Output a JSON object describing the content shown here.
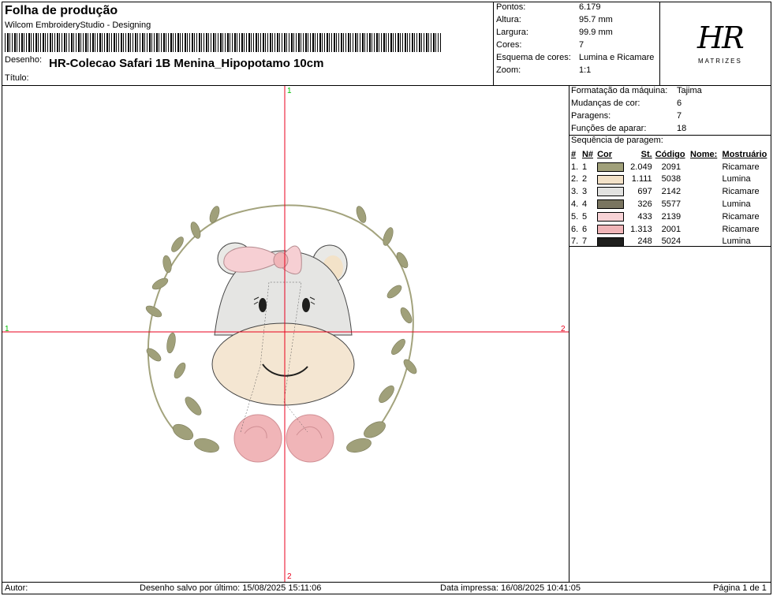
{
  "header": {
    "title": "Folha de produção",
    "software": "Wilcom EmbroideryStudio - Designing",
    "design_label": "Desenho:",
    "design_name": "HR-Colecao Safari 1B Menina_Hipopotamo 10cm",
    "title_label": "Título:"
  },
  "stats": [
    {
      "label": "Pontos:",
      "value": "6.179"
    },
    {
      "label": "Altura:",
      "value": "95.7 mm"
    },
    {
      "label": "Largura:",
      "value": "99.9 mm"
    },
    {
      "label": "Cores:",
      "value": "7"
    },
    {
      "label": "Esquema de cores:",
      "value": "Lumina e Ricamare"
    },
    {
      "label": "Zoom:",
      "value": "1:1"
    }
  ],
  "logo": {
    "mark": "HR",
    "sub": "MATRIZES"
  },
  "machine": [
    {
      "label": "Formatação da máquina:",
      "value": "Tajima"
    },
    {
      "label": "Mudanças de cor:",
      "value": "6"
    },
    {
      "label": "Paragens:",
      "value": "7"
    },
    {
      "label": "Funções de aparar:",
      "value": "18"
    }
  ],
  "sequence": {
    "title": "Sequência de paragem:",
    "headers": {
      "idx": "#",
      "num": "N#",
      "color": "Cor",
      "stitches": "St.",
      "code": "Código",
      "name": "Nome:",
      "chart": "Mostruário"
    },
    "rows": [
      {
        "idx": "1.",
        "num": "1",
        "color": "#a0a07a",
        "stitches": "2.049",
        "code": "2091",
        "chart": "Ricamare"
      },
      {
        "idx": "2.",
        "num": "2",
        "color": "#f3e2c8",
        "stitches": "1.111",
        "code": "5038",
        "chart": "Lumina"
      },
      {
        "idx": "3.",
        "num": "3",
        "color": "#e2e2e0",
        "stitches": "697",
        "code": "2142",
        "chart": "Ricamare"
      },
      {
        "idx": "4.",
        "num": "4",
        "color": "#7a7560",
        "stitches": "326",
        "code": "5577",
        "chart": "Lumina"
      },
      {
        "idx": "5.",
        "num": "5",
        "color": "#f8d3d6",
        "stitches": "433",
        "code": "2139",
        "chart": "Ricamare"
      },
      {
        "idx": "6.",
        "num": "6",
        "color": "#f0b5b8",
        "stitches": "1.313",
        "code": "2001",
        "chart": "Ricamare"
      },
      {
        "idx": "7.",
        "num": "7",
        "color": "#1f1f1d",
        "stitches": "248",
        "code": "5024",
        "chart": "Lumina"
      }
    ]
  },
  "axes": {
    "top": "1",
    "left": "1",
    "right": "2",
    "bottom": "2"
  },
  "footer": {
    "author_label": "Autor:",
    "saved": "Desenho salvo por último: 15/08/2025 15:11:06",
    "printed": "Data impressa: 16/08/2025 10:41:05",
    "page": "Página 1 de 1"
  },
  "colors": {
    "axis": "#e8001c",
    "axis_num": "#00c000"
  }
}
